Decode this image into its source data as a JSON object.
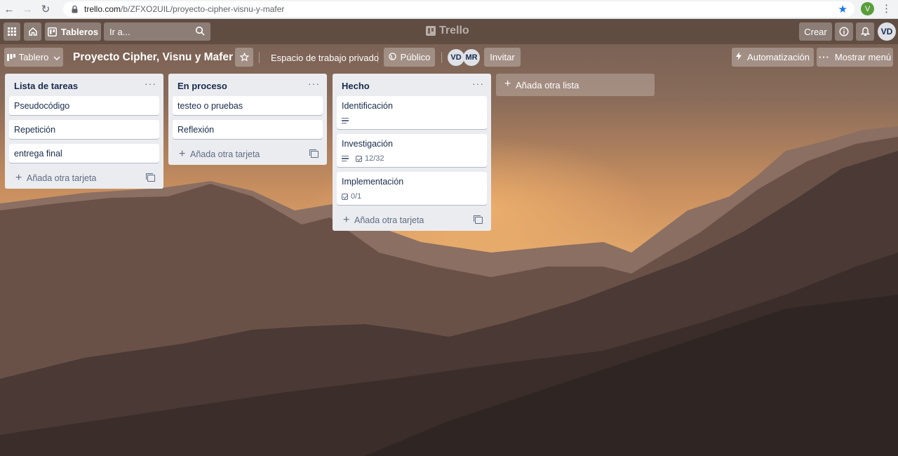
{
  "browser": {
    "url_host": "trello.com",
    "url_path": "/b/ZFXO2UIL/proyecto-cipher-visnu-y-mafer",
    "profile_initial": "V"
  },
  "header": {
    "boards_label": "Tableros",
    "search_placeholder": "Ir a...",
    "logo_text": "Trello",
    "create_label": "Crear",
    "user_initials": "VD"
  },
  "board": {
    "view_label": "Tablero",
    "title": "Proyecto Cipher, Visnu y Mafer",
    "workspace": "Espacio de trabajo privado",
    "visibility": "Público",
    "members": [
      "VD",
      "MR"
    ],
    "invite_label": "Invitar",
    "automation_label": "Automatización",
    "menu_label": "Mostrar menú"
  },
  "lists": [
    {
      "title": "Lista de tareas",
      "cards": [
        {
          "title": "Pseudocódigo"
        },
        {
          "title": "Repetición"
        },
        {
          "title": "entrega final"
        }
      ],
      "add_card_label": "Añada otra tarjeta"
    },
    {
      "title": "En proceso",
      "cards": [
        {
          "title": "testeo o pruebas"
        },
        {
          "title": "Reflexión"
        }
      ],
      "add_card_label": "Añada otra tarjeta"
    },
    {
      "title": "Hecho",
      "cards": [
        {
          "title": "Identificación",
          "has_description": true
        },
        {
          "title": "Investigación",
          "has_description": true,
          "checklist": "12/32"
        },
        {
          "title": "Implementación",
          "checklist": "0/1"
        }
      ],
      "add_card_label": "Añada otra tarjeta"
    }
  ],
  "add_list_label": "Añada otra lista",
  "colors": {
    "list_bg": "#ebecf0",
    "card_bg": "#ffffff",
    "text": "#172b4d",
    "muted": "#5e6c84",
    "bookmark_star": "#1a73e8",
    "profile_green": "#5a9e3a"
  }
}
